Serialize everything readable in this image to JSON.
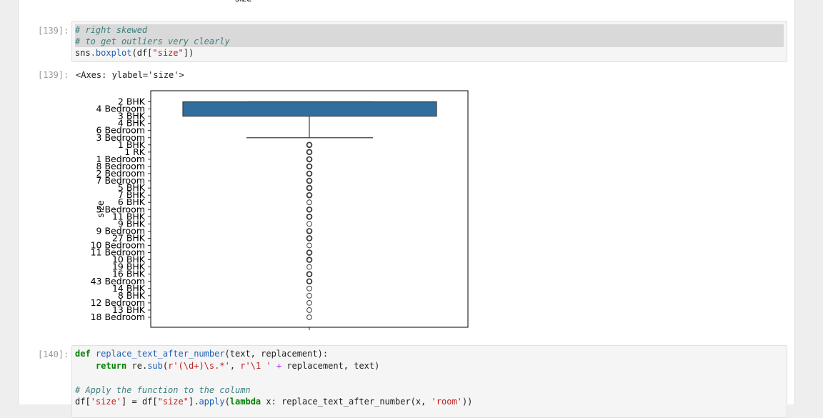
{
  "cells": {
    "prev_fragment": "size",
    "in139": {
      "prompt": "[139]:",
      "comment1": "# right skewed",
      "comment2": "# to get outliers very clearly",
      "code_obj": "sns",
      "code_dot": ".",
      "code_fn": "boxplot",
      "code_open": "(df[",
      "code_str": "\"size\"",
      "code_close": "])"
    },
    "out139": {
      "prompt": "[139]:",
      "text": "<Axes: ylabel='size'>"
    },
    "in140": {
      "prompt": "[140]:",
      "l1_kw": "def",
      "l1_fn": "replace_text_after_number",
      "l1_rest": "(text, replacement):",
      "l2_kw": "return",
      "l2_obj": "re.",
      "l2_fn": "sub",
      "l2_p1": "(",
      "l2_s1": "r'(\\d+)\\s.*'",
      "l2_p2": ", ",
      "l2_s2": "r'\\1 '",
      "l2_op": " + ",
      "l2_rest": "replacement, text)",
      "l4_cm": "# Apply the function to the column",
      "l5_a": "df[",
      "l5_s1": "'size'",
      "l5_b": "] = df[",
      "l5_s2": "\"size\"",
      "l5_c": "].",
      "l5_fn": "apply",
      "l5_d": "(",
      "l5_kw": "lambda",
      "l5_e": " x: replace_text_after_number(x, ",
      "l5_s3": "'room'",
      "l5_f": "))"
    }
  },
  "chart_data": {
    "type": "box",
    "orientation": "vertical",
    "ylabel": "size",
    "xlabel": "",
    "categories": [
      "2 BHK",
      "4 Bedroom",
      "3 BHK",
      "4 BHK",
      "6 Bedroom",
      "3 Bedroom",
      "1 BHK",
      "1 RK",
      "1 Bedroom",
      "8 Bedroom",
      "2 Bedroom",
      "7 Bedroom",
      "5 BHK",
      "7 BHK",
      "6 BHK",
      "5 Bedroom",
      "11 BHK",
      "9 BHK",
      "9 Bedroom",
      "27 BHK",
      "10 Bedroom",
      "11 Bedroom",
      "10 BHK",
      "19 BHK",
      "16 BHK",
      "43 Bedroom",
      "14 BHK",
      "8 BHK",
      "12 Bedroom",
      "13 BHK",
      "18 Bedroom"
    ],
    "box": {
      "q1": 0,
      "median": 0,
      "q3": 2,
      "whisker_low": 0,
      "whisker_high": 5
    },
    "outliers": [
      6,
      7,
      8,
      9,
      10,
      11,
      12,
      13,
      14,
      15,
      16,
      17,
      18,
      19,
      20,
      21,
      22,
      23,
      24,
      25,
      26,
      27,
      28,
      29,
      30
    ],
    "box_color": "#2f6e9e",
    "ylim": [
      -0.5,
      30.5
    ],
    "grid": false,
    "legend": "none"
  }
}
